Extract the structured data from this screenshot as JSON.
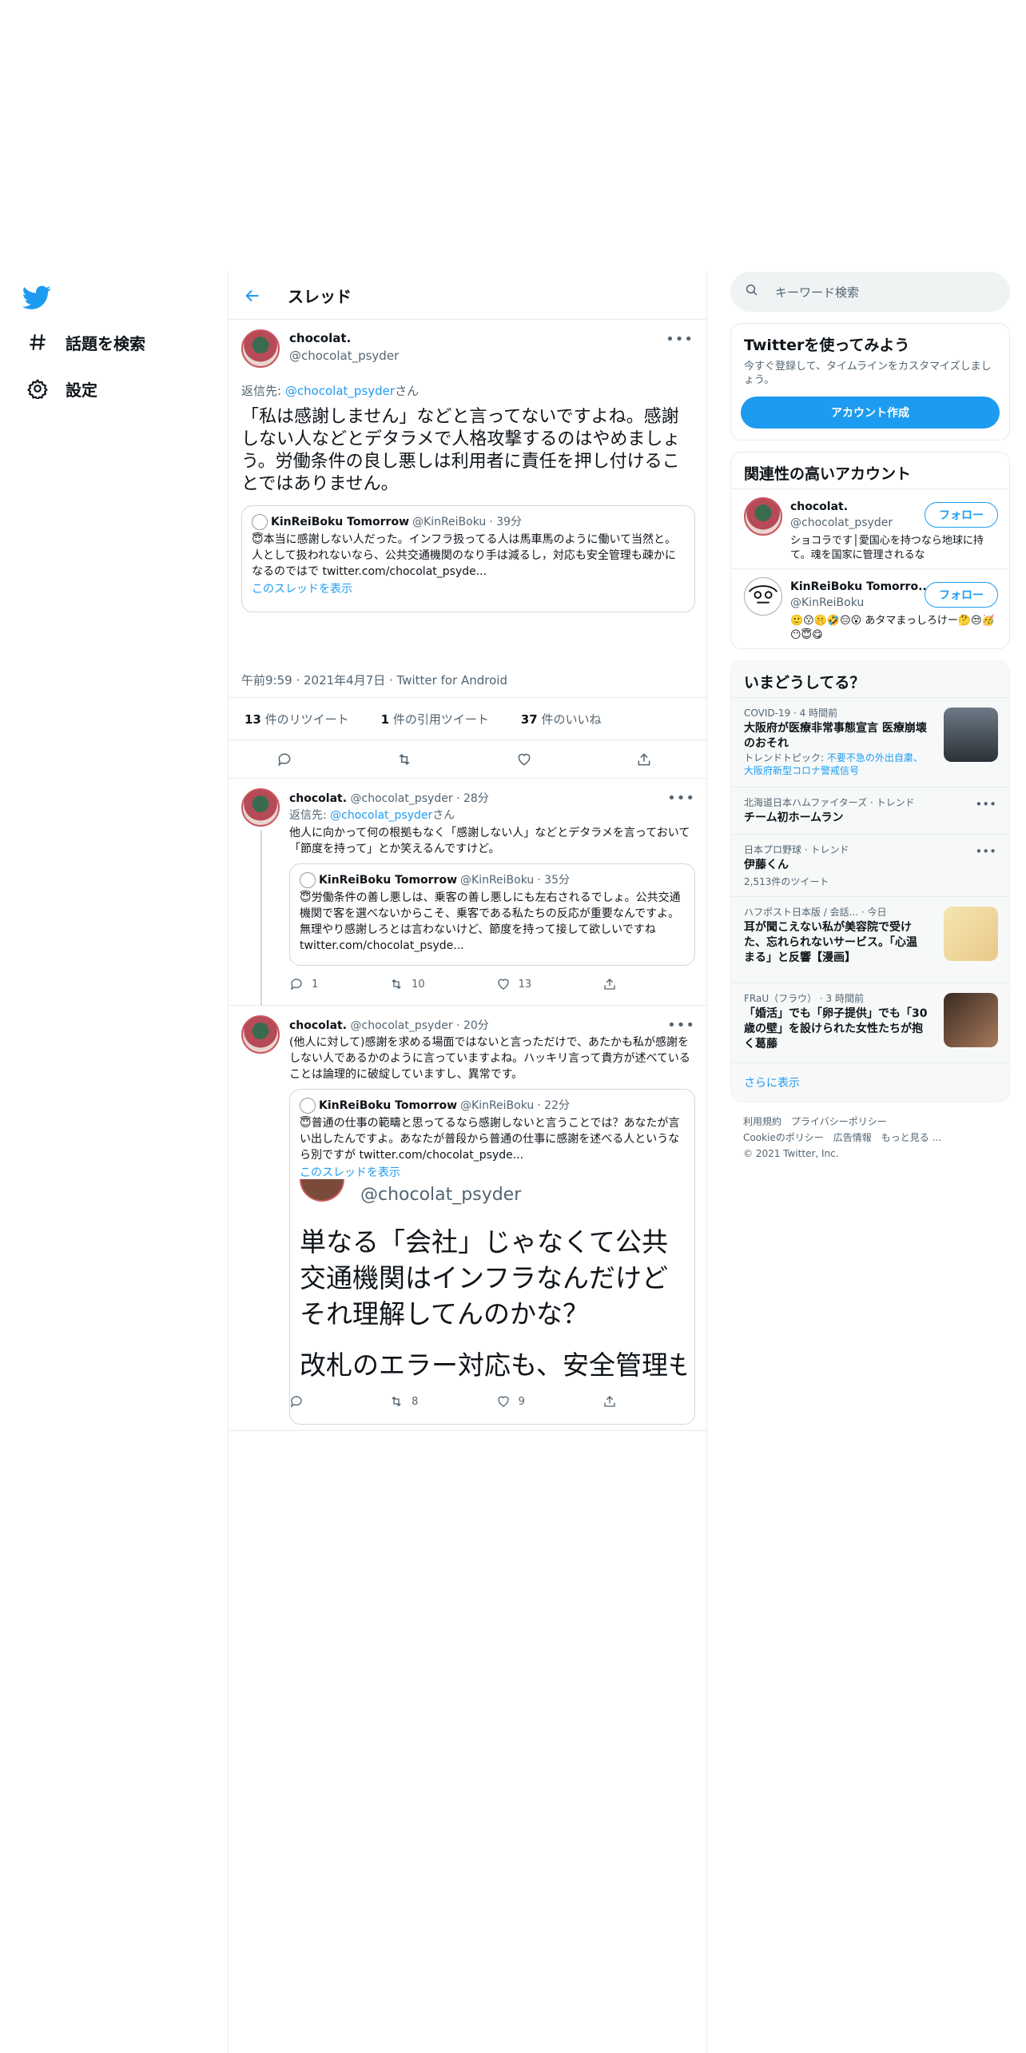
{
  "nav": {
    "items": [
      {
        "label": "話題を検索",
        "icon": "hashtag-icon"
      },
      {
        "label": "設定",
        "icon": "gear-icon"
      }
    ]
  },
  "header": {
    "title": "スレッド"
  },
  "main_tweet": {
    "name": "chocolat.",
    "handle": "@chocolat_psyder",
    "reply_prefix": "返信先: ",
    "reply_handle": "@chocolat_psyder",
    "reply_suffix": "さん",
    "text": "「私は感謝しません」などと言ってないですよね。感謝しない人などとデタラメで人格攻撃するのはやめましょう。労働条件の良し悪しは利用者に責任を押し付けることではありません。",
    "quote": {
      "name": "KinReiBoku Tomorrow",
      "handle": "@KinReiBoku",
      "time": "· 39分",
      "text": "😇本当に感謝しない人だった。インフラ扱ってる人は馬車馬のように働いて当然と。人として扱われないなら、公共交通機関のなり手は減るし，対応も安全管理も疎かになるのではで twitter.com/chocolat_psyde...",
      "link": "このスレッドを表示"
    },
    "meta": "午前9:59 · 2021年4月7日 · Twitter for Android",
    "retweets_count": "13",
    "retweets_label": " 件のリツイート",
    "quotes_count": "1",
    "quotes_label": " 件の引用ツイート",
    "likes_count": "37",
    "likes_label": " 件のいいね"
  },
  "replies": [
    {
      "name": "chocolat.",
      "handle": "@chocolat_psyder · 28分",
      "reply_prefix": "返信先: ",
      "reply_handle": "@chocolat_psyder",
      "reply_suffix": "さん",
      "text": "他人に向かって何の根拠もなく「感謝しない人」などとデタラメを言っておいて「節度を持って」とか笑えるんですけど。",
      "quote": {
        "name": "KinReiBoku Tomorrow",
        "handle": "@KinReiBoku",
        "time": "· 35分",
        "text": "😇労働条件の善し悪しは、乗客の善し悪しにも左右されるでしょ。公共交通機関で客を選べないからこそ、乗客である私たちの反応が重要なんですよ。無理やり感謝しろとは言わないけど、節度を持って接して欲しいですね twitter.com/chocolat_psyde..."
      },
      "reply_count": "1",
      "retweet_count": "10",
      "like_count": "13"
    },
    {
      "name": "chocolat.",
      "handle": "@chocolat_psyder · 20分",
      "text": "(他人に対して)感謝を求める場面ではないと言っただけで、あたかも私が感謝をしない人であるかのように言っていますよね。ハッキリ言って貴方が述べていることは論理的に破綻していますし、異常です。",
      "quote": {
        "name": "KinReiBoku Tomorrow",
        "handle": "@KinReiBoku",
        "time": "· 22分",
        "text": "😇普通の仕事の範疇と思ってるなら感謝しないと言うことでは？あなたが言い出したんですよ。あなたが普段から普通の仕事に感謝を述べる人というなら別ですが  twitter.com/chocolat_psyde...",
        "link": "このスレッドを表示",
        "image_handle": "@chocolat_psyder",
        "image_text": "単なる「会社」じゃなくて公共交通機関はインフラなんだけどそれ理解してんのかな？",
        "image_text2": "改札のエラー対応も、安全管理も、障碍者への対応も普通の仕"
      },
      "reply_count": "",
      "retweet_count": "8",
      "like_count": "9"
    }
  ],
  "sidebar": {
    "search_placeholder": "キーワード検索",
    "signup": {
      "title": "Twitterを使ってみよう",
      "sub": "今すぐ登録して、タイムラインをカスタマイズしましょう。",
      "button": "アカウント作成"
    },
    "related": {
      "title": "関連性の高いアカウント",
      "accounts": [
        {
          "name": "chocolat.",
          "handle": "@chocolat_psyder",
          "bio": "ショコラです│愛国心を持つなら地球に持て。魂を国家に管理されるな",
          "follow": "フォロー"
        },
        {
          "name": "KinReiBoku Tomorro...",
          "handle": "@KinReiBoku",
          "bio": "🙂😗🤫🤣😑😮 あタマまっしろけー🤔😒🥳😶😇😋",
          "follow": "フォロー"
        }
      ]
    },
    "trends": {
      "title": "いまどうしてる？",
      "items": [
        {
          "context": "COVID-19 · 4 時間前",
          "title": "大阪府が医療非常事態宣言 医療崩壊のおそれ",
          "topic_prefix": "トレンドトピック: ",
          "topic": "不要不急の外出自粛、大阪府新型コロナ警戒信号"
        },
        {
          "context": "北海道日本ハムファイターズ · トレンド",
          "title": "チーム初ホームラン"
        },
        {
          "context": "日本プロ野球 · トレンド",
          "title": "伊藤くん",
          "count": "2,513件のツイート"
        },
        {
          "context": "ハフポスト日本版 / 会話... · 今日",
          "title": "耳が聞こえない私が美容院で受けた、忘れられないサービス。「心温まる」と反響【漫画】"
        },
        {
          "context": "FRaU（フラウ） · 3 時間前",
          "title": "「婚活」でも「卵子提供」でも「30歳の壁」を設けられた女性たちが抱く葛藤"
        }
      ],
      "show_more": "さらに表示"
    },
    "footer": {
      "links": [
        "利用規約",
        "プライバシーポリシー",
        "Cookieのポリシー",
        "広告情報",
        "もっと見る ..."
      ],
      "copyright": "© 2021 Twitter, Inc."
    }
  },
  "colors": {
    "accent": "#1d9bf0",
    "text": "#0f1419",
    "muted": "#536471",
    "border": "#e6ecf0"
  }
}
